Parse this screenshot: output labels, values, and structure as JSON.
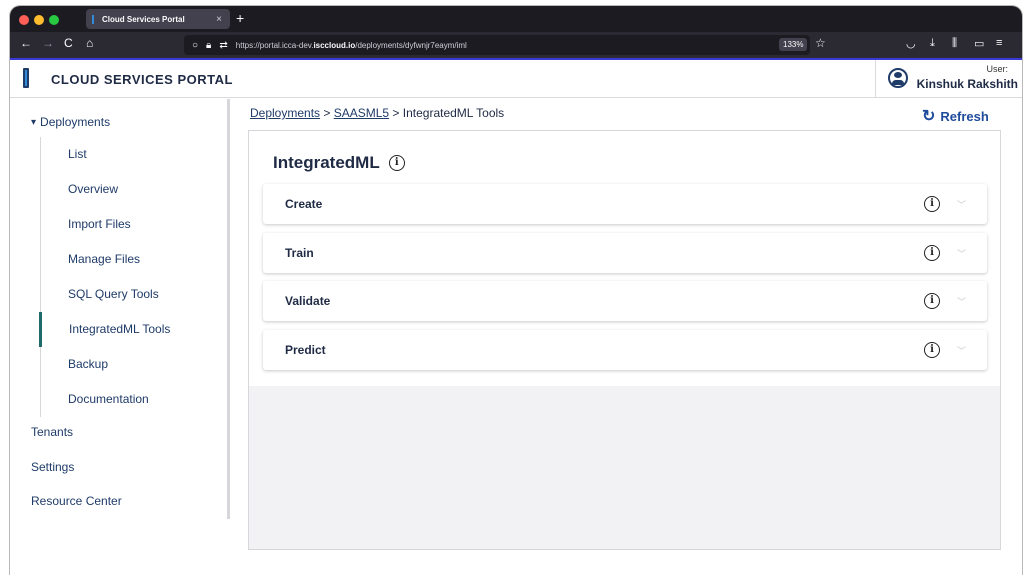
{
  "browser": {
    "tab_title": "Cloud Services Portal",
    "tab_close": "×",
    "new_tab": "+",
    "nav_back": "←",
    "nav_forward": "→",
    "nav_reload": "C",
    "nav_home": "⌂",
    "url_prefix": "https://portal.icca-dev.",
    "url_host": "isccloud.io",
    "url_path": "/deployments/dyfwnjr7eaym/iml",
    "zoom": "133%",
    "bookmark_icon": "☆",
    "right_icons": [
      "pocket-icon",
      "download-icon",
      "library-icon",
      "sidebar-icon",
      "extensions-icon"
    ]
  },
  "header": {
    "app_title": "CLOUD SERVICES PORTAL",
    "user_label": "User:",
    "user_name": "Kinshuk Rakshith"
  },
  "sidebar": {
    "deployments": "Deployments",
    "items": [
      {
        "label": "List"
      },
      {
        "label": "Overview"
      },
      {
        "label": "Import Files"
      },
      {
        "label": "Manage Files"
      },
      {
        "label": "SQL Query Tools"
      },
      {
        "label": "IntegratedML Tools",
        "active": true
      },
      {
        "label": "Backup"
      },
      {
        "label": "Documentation"
      }
    ],
    "tenants": "Tenants",
    "settings": "Settings",
    "resource_center": "Resource Center"
  },
  "breadcrumb": {
    "part1": "Deployments",
    "sep1": " > ",
    "part2": "SAASML5",
    "sep2": " > ",
    "part3": "IntegratedML Tools"
  },
  "refresh_label": "Refresh",
  "main": {
    "title": "IntegratedML",
    "info_glyph": "i",
    "sections": [
      {
        "label": "Create"
      },
      {
        "label": "Train"
      },
      {
        "label": "Validate"
      },
      {
        "label": "Predict"
      }
    ]
  },
  "colors": {
    "brand_dark": "#1f3b68",
    "accent_blue": "#1f4b9c",
    "active_marker": "#1f6b6b"
  }
}
